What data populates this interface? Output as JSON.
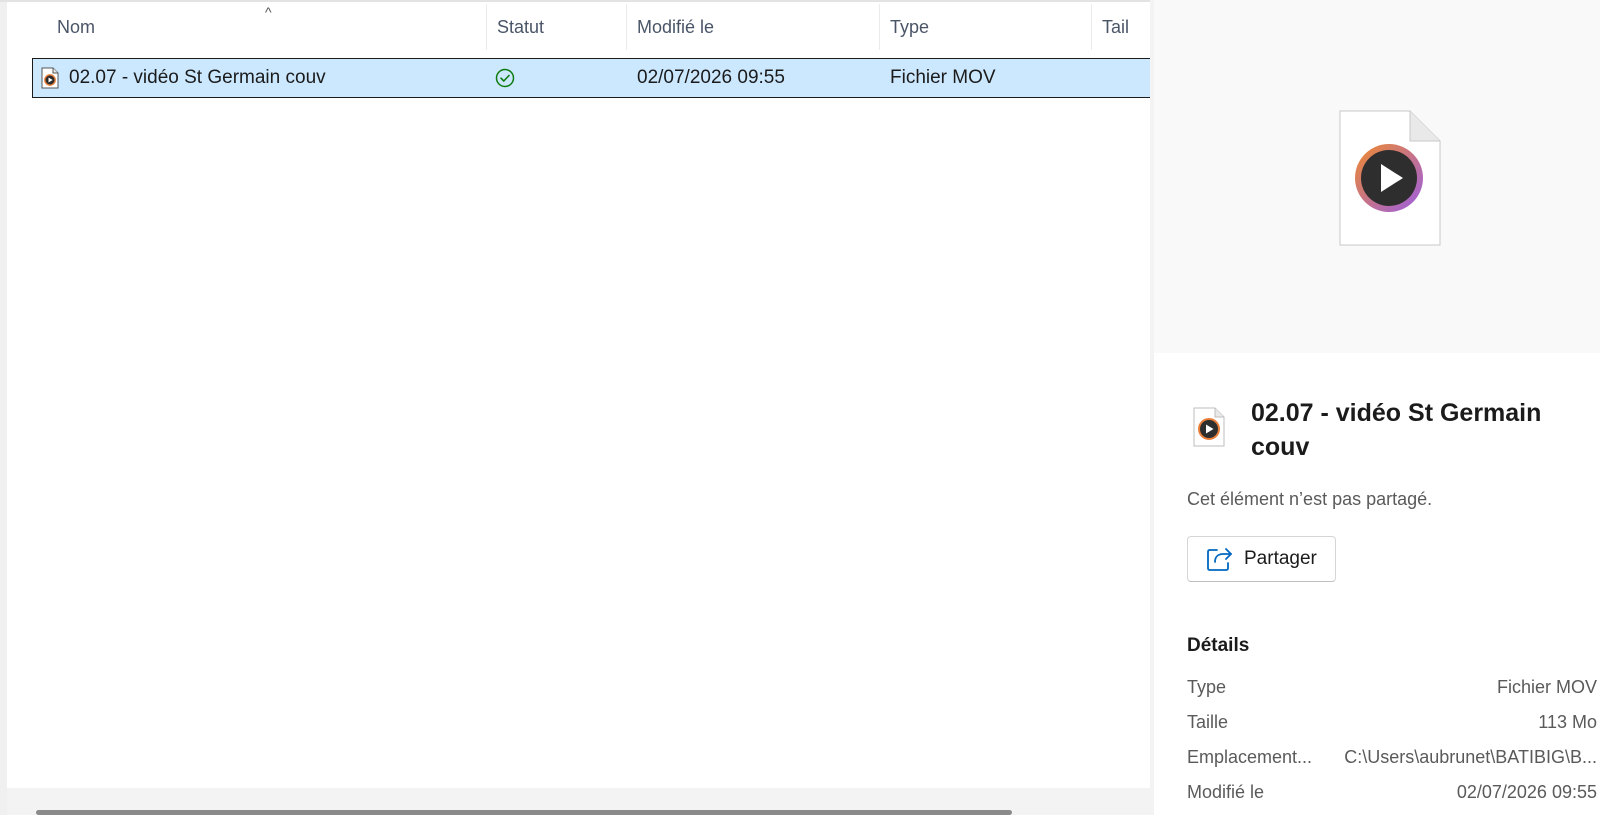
{
  "columns": {
    "name": "Nom",
    "status": "Statut",
    "modified": "Modifié le",
    "type": "Type",
    "size": "Tail"
  },
  "sort_indicator": "^",
  "files": [
    {
      "name": "02.07 - vidéo St Germain couv",
      "status": "synced",
      "modified": "02/07/2026 09:55",
      "type": "Fichier MOV",
      "icon": "video-file-icon"
    }
  ],
  "details": {
    "title": "02.07 - vidéo St Germain couv",
    "share_status": "Cet élément n’est pas partagé.",
    "share_button": "Partager",
    "section_heading": "Détails",
    "properties": [
      {
        "label": "Type",
        "value": "Fichier MOV"
      },
      {
        "label": "Taille",
        "value": "113 Mo"
      },
      {
        "label": "Emplacement...",
        "value": "C:\\Users\\aubrunet\\BATIBIG\\B..."
      },
      {
        "label": "Modifié le",
        "value": "02/07/2026 09:55"
      }
    ]
  },
  "colors": {
    "selection": "#cce8ff",
    "status_ok": "#0f7b0f",
    "accent": "#0067c0"
  }
}
